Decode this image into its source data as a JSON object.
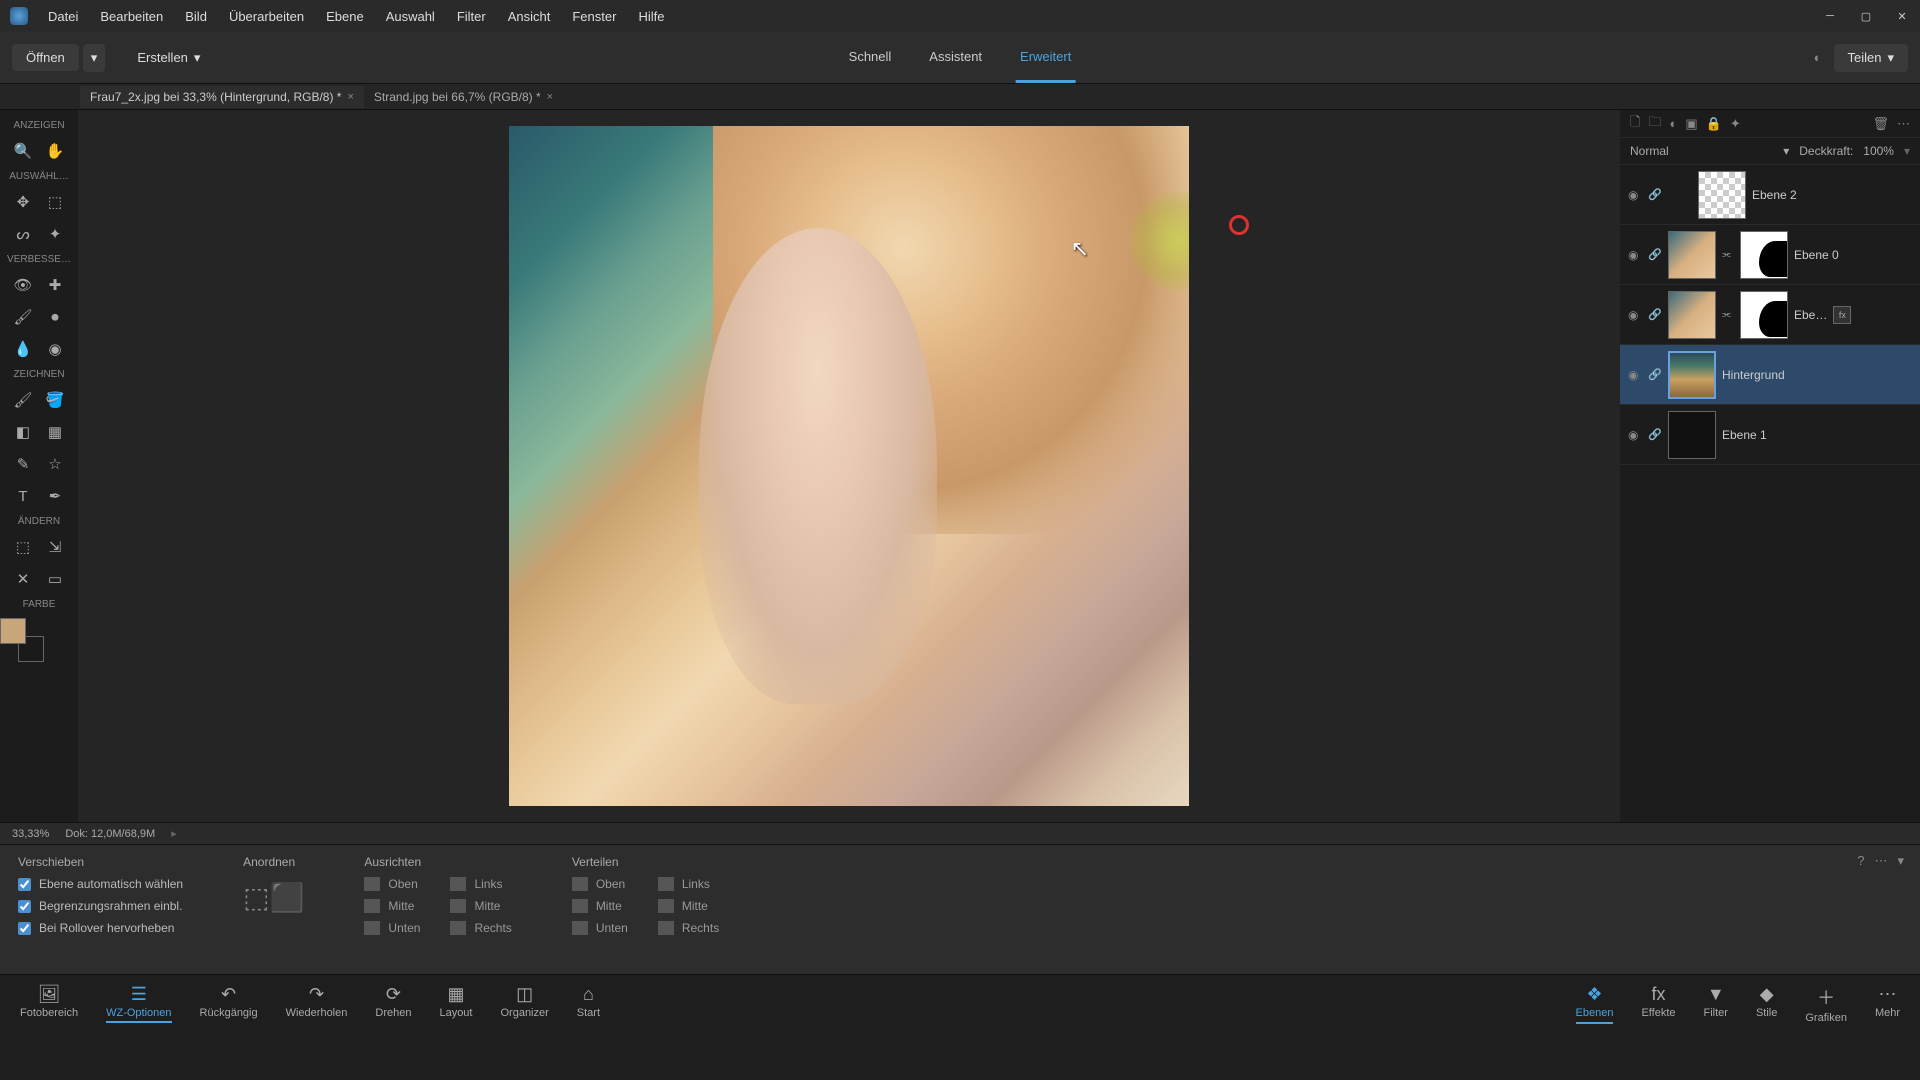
{
  "menu": [
    "Datei",
    "Bearbeiten",
    "Bild",
    "Überarbeiten",
    "Ebene",
    "Auswahl",
    "Filter",
    "Ansicht",
    "Fenster",
    "Hilfe"
  ],
  "secondary": {
    "open": "Öffnen",
    "create": "Erstellen",
    "share": "Teilen"
  },
  "modes": {
    "quick": "Schnell",
    "guided": "Assistent",
    "expert": "Erweitert"
  },
  "doc_tabs": [
    {
      "label": "Frau7_2x.jpg bei 33,3% (Hintergrund, RGB/8) *",
      "active": true
    },
    {
      "label": "Strand.jpg bei 66,7% (RGB/8) *",
      "active": false
    }
  ],
  "tool_sections": {
    "anzeigen": "ANZEIGEN",
    "auswaehl": "AUSWÄHL…",
    "verbesse": "VERBESSE…",
    "zeichnen": "ZEICHNEN",
    "aendern": "ÄNDERN",
    "farbe": "FARBE"
  },
  "status": {
    "zoom": "33,33%",
    "doc": "Dok: 12,0M/68,9M"
  },
  "options": {
    "title": "Verschieben",
    "checks": [
      "Ebene automatisch wählen",
      "Begrenzungsrahmen einbl.",
      "Bei Rollover hervorheben"
    ],
    "arrange": "Anordnen",
    "align": "Ausrichten",
    "distribute": "Verteilen",
    "oben": "Oben",
    "mitte": "Mitte",
    "unten": "Unten",
    "links": "Links",
    "rechts": "Rechts"
  },
  "dock_left": [
    "Fotobereich",
    "WZ-Optionen",
    "Rückgängig",
    "Wiederholen",
    "Drehen",
    "Layout",
    "Organizer",
    "Start"
  ],
  "dock_right": [
    "Ebenen",
    "Effekte",
    "Filter",
    "Stile",
    "Grafiken",
    "Mehr"
  ],
  "layers": {
    "blend_mode": "Normal",
    "opacity_label": "Deckkraft:",
    "opacity_value": "100%",
    "items": [
      {
        "name": "Ebene 2"
      },
      {
        "name": "Ebene 0"
      },
      {
        "name": "Ebe…"
      },
      {
        "name": "Hintergrund"
      },
      {
        "name": "Ebene 1"
      }
    ]
  }
}
